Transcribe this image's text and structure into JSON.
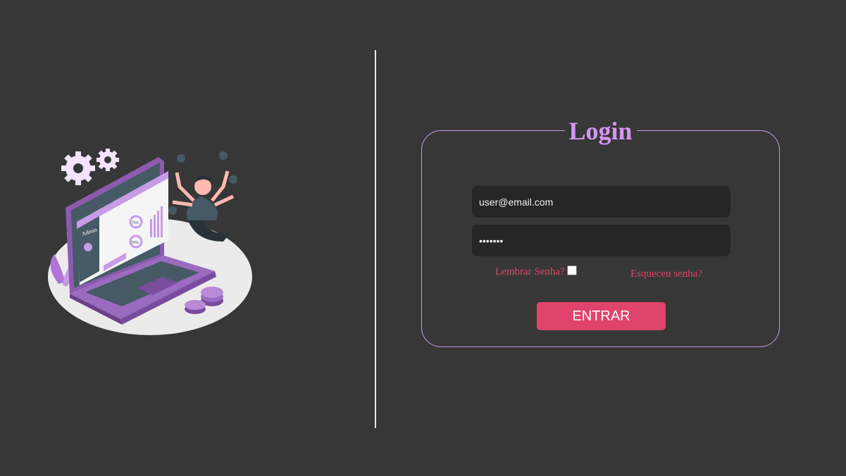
{
  "colors": {
    "background": "#373737",
    "accent_purple": "#d596f2",
    "border_purple": "#c79be8",
    "accent_pink": "#e0446c",
    "field_background": "#262626",
    "divider": "#e8e8e8"
  },
  "illustration": {
    "name": "admin-multitasking-illustration",
    "screen_label": "Admin",
    "gauge_1": "75%",
    "gauge_2": "50%"
  },
  "login": {
    "title": "Login",
    "email": {
      "value": "user@email.com",
      "placeholder": "user@email.com"
    },
    "password": {
      "value": "1234567",
      "placeholder": "*******"
    },
    "remember_label": "Lembrar Senha?",
    "remember_checked": false,
    "forgot_label": "Esqueceu senha?",
    "submit_label": "ENTRAR"
  }
}
